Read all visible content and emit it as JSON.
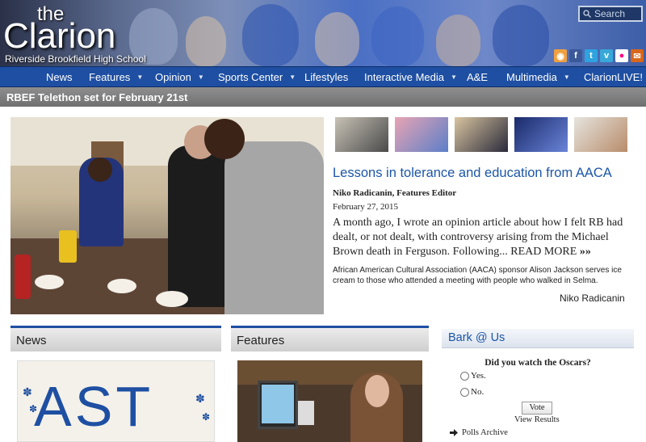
{
  "header": {
    "logo_the": "the",
    "logo_name": "Clarion",
    "school": "Riverside Brookfield High School",
    "search_placeholder": "Search"
  },
  "social_icons": [
    {
      "name": "rss-icon",
      "color": "#f0a040",
      "glyph": "◉"
    },
    {
      "name": "facebook-icon",
      "color": "#3b5998",
      "glyph": "f"
    },
    {
      "name": "twitter-icon",
      "color": "#2fa3e0",
      "glyph": "t"
    },
    {
      "name": "vimeo-icon",
      "color": "#38a8d8",
      "glyph": "v"
    },
    {
      "name": "flickr-icon",
      "color": "#ffffff",
      "glyph": "●"
    },
    {
      "name": "email-icon",
      "color": "#d9661a",
      "glyph": "✉"
    }
  ],
  "nav": [
    {
      "label": "News",
      "dropdown": false
    },
    {
      "label": "Features",
      "dropdown": true
    },
    {
      "label": "Opinion",
      "dropdown": true
    },
    {
      "label": "Sports Center",
      "dropdown": true
    },
    {
      "label": "Lifestyles",
      "dropdown": false
    },
    {
      "label": "Interactive Media",
      "dropdown": true
    },
    {
      "label": "A&E",
      "dropdown": false
    },
    {
      "label": "Multimedia",
      "dropdown": true
    },
    {
      "label": "ClarionLIVE!",
      "dropdown": false
    }
  ],
  "breaking": "RBEF Telethon set for February 21st",
  "featured": {
    "headline": "Lessons in tolerance and education from AACA",
    "byline": "Niko Radicanin, Features Editor",
    "date": "February 27, 2015",
    "excerpt": "A month ago, I wrote an opinion article about how I felt RB had dealt, or not dealt, with controversy arising from the Michael Brown death in Ferguson. Following...",
    "read_more": "READ MORE",
    "read_more_arrows": "»»",
    "caption": "African American Cultural Association (AACA) sponsor Alison Jackson serves ice cream to those who attended a meeting with people who walked in Selma.",
    "credit": "Niko Radicanin"
  },
  "sections": {
    "news": "News",
    "features": "Features",
    "news_image_text": "AST"
  },
  "poll": {
    "title": "Bark @ Us",
    "question": "Did you watch the Oscars?",
    "options": [
      "Yes.",
      "No."
    ],
    "vote": "Vote",
    "results": "View Results",
    "archive": "Polls Archive"
  },
  "colors": {
    "nav_blue": "#1e4fa2",
    "link_blue": "#1b56a8",
    "breaking_gray": "#7f7f7f"
  }
}
